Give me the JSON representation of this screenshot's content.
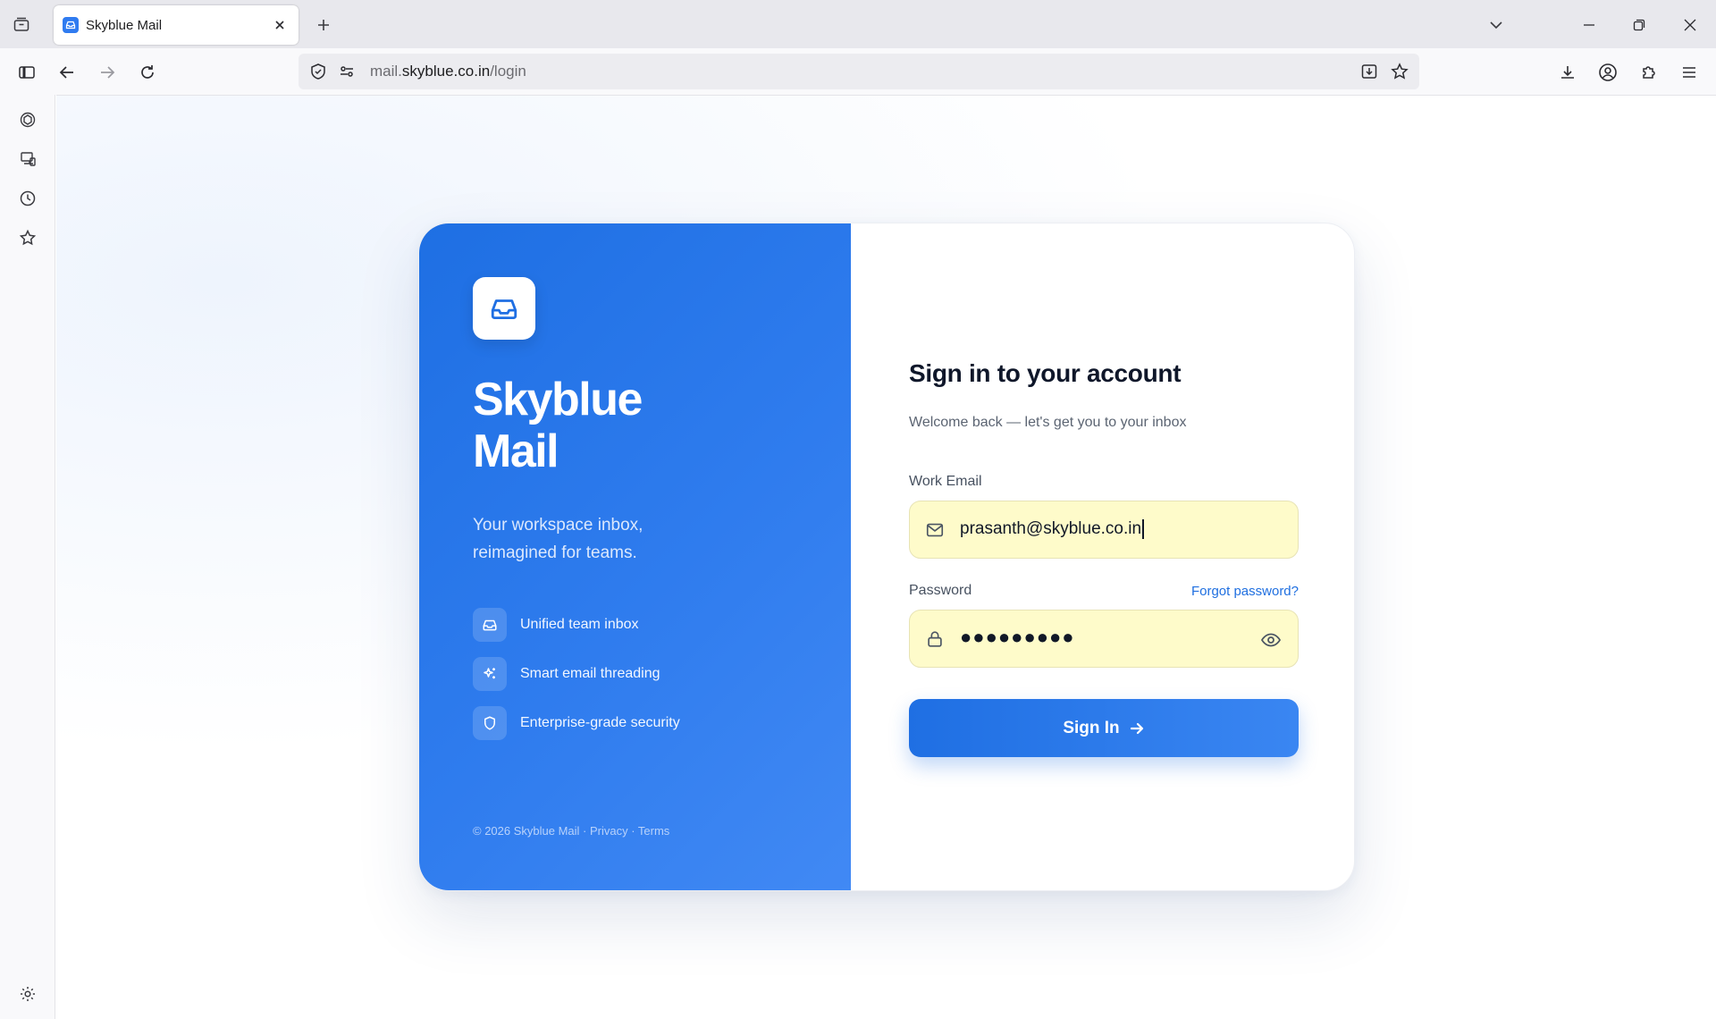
{
  "browser": {
    "tab": {
      "title": "Skyblue Mail"
    },
    "url": {
      "prefix": "mail.",
      "host": "skyblue.co.in",
      "path": "/login"
    }
  },
  "brand": {
    "name_line1": "Skyblue",
    "name_line2": "Mail",
    "tagline_line1": "Your workspace inbox,",
    "tagline_line2": "reimagined for teams.",
    "features": [
      {
        "label": "Unified team inbox",
        "icon": "inbox-icon"
      },
      {
        "label": "Smart email threading",
        "icon": "sparkles-icon"
      },
      {
        "label": "Enterprise-grade security",
        "icon": "shield-icon"
      }
    ],
    "footer": "© 2026 Skyblue Mail · Privacy · Terms"
  },
  "form": {
    "title": "Sign in to your account",
    "subtitle": "Welcome back — let's get you to your inbox",
    "email_label": "Work Email",
    "email_value": "prasanth@skyblue.co.in",
    "password_label": "Password",
    "password_mask": "●●●●●●●●●",
    "forgot_label": "Forgot password?",
    "submit_label": "Sign In"
  },
  "colors": {
    "accent": "#1f6fe3",
    "input_autofill_bg": "#fefbca",
    "link": "#1f6fe0"
  }
}
